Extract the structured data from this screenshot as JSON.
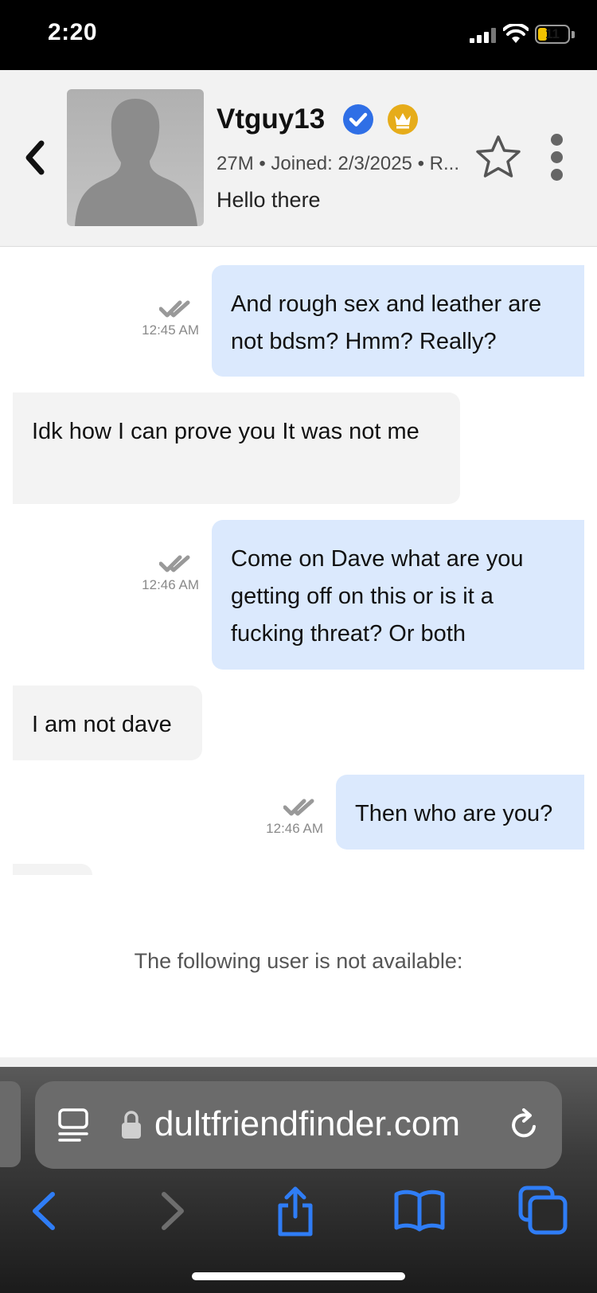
{
  "status_bar": {
    "time": "2:20",
    "battery": "11"
  },
  "header": {
    "username": "Vtguy13",
    "meta": "27M • Joined: 2/3/2025 • R...",
    "status_message": "Hello there",
    "icons": {
      "back": "chevron-left-icon",
      "verified": "verified-check-icon",
      "vip": "crown-icon",
      "favorite": "star-icon",
      "more": "more-vertical-icon"
    },
    "colors": {
      "verified": "#2f6fe6",
      "vip": "#e6ac1a"
    }
  },
  "messages": [
    {
      "direction": "outgoing",
      "text": "And rough sex and leather are not bdsm? Hmm? Really?",
      "time": "12:45 AM"
    },
    {
      "direction": "incoming",
      "text": "Idk how I can prove you It was not me"
    },
    {
      "direction": "outgoing",
      "text": "Come on Dave what are you getting off on this or is it a fucking threat? Or both",
      "time": "12:46 AM"
    },
    {
      "direction": "incoming",
      "text": "I am not dave"
    },
    {
      "direction": "outgoing",
      "text": "Then who are you?",
      "time": "12:46 AM"
    }
  ],
  "notice": "The following user is not available:",
  "browser": {
    "url": "dultfriendfinder.com",
    "icons": {
      "reader": "reader-mode-icon",
      "lock": "lock-icon",
      "reload": "reload-icon",
      "back": "back-arrow-icon",
      "forward": "forward-arrow-icon",
      "share": "share-icon",
      "bookmarks": "book-icon",
      "tabs": "tabs-icon"
    },
    "accent": "#2f7df6"
  }
}
